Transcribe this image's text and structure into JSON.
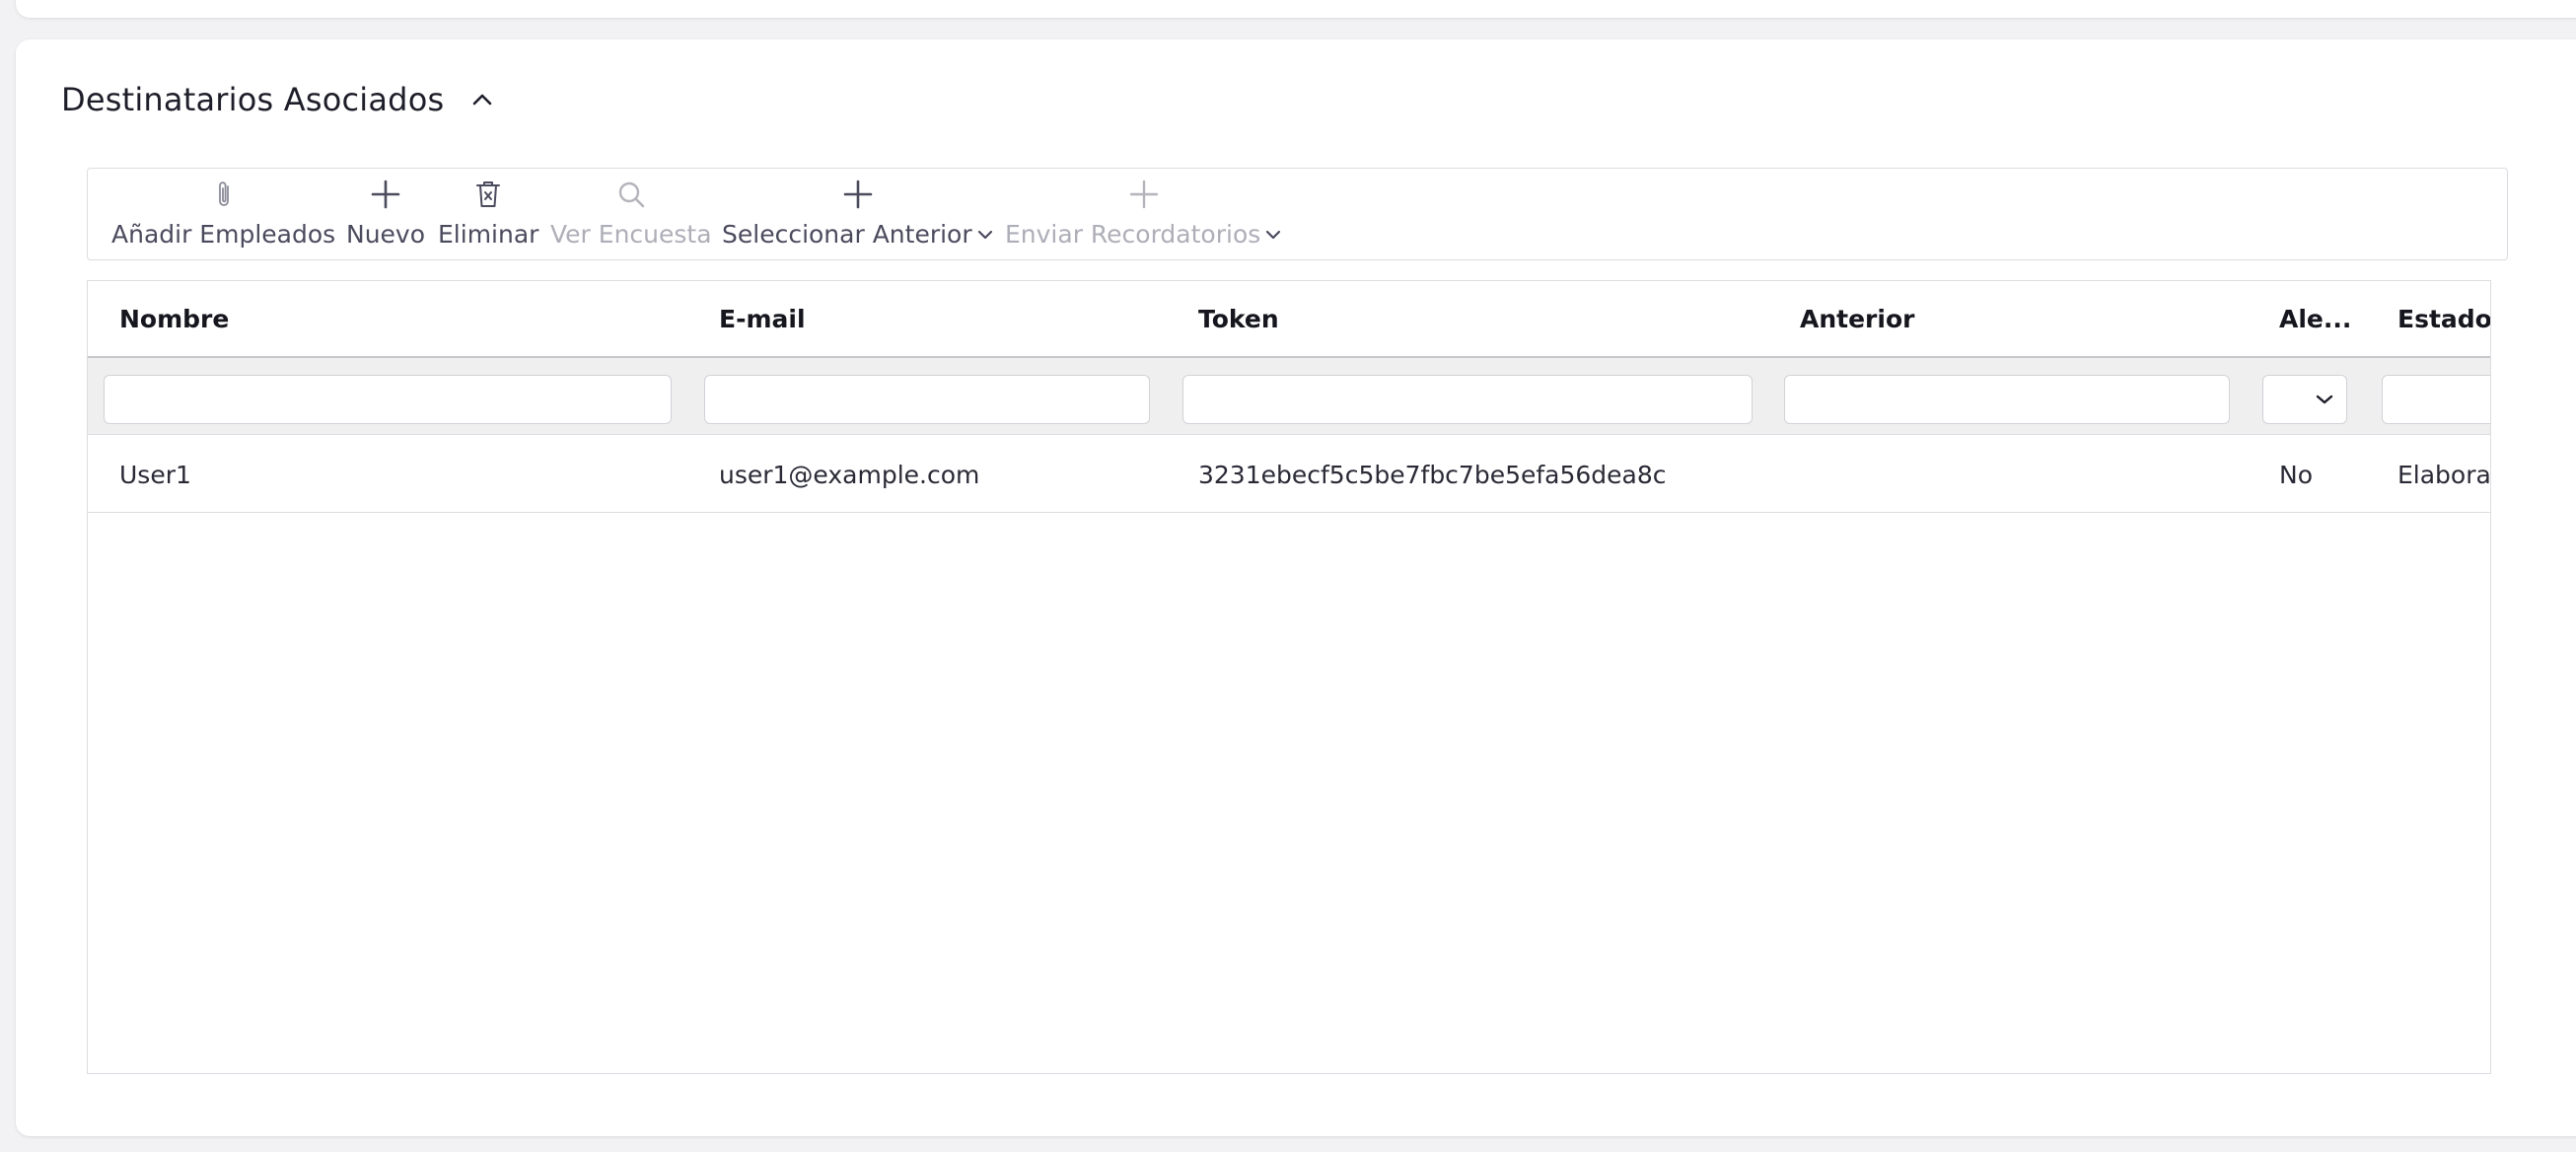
{
  "section": {
    "title": "Destinatarios Asociados"
  },
  "toolbar": {
    "add_employees": "Añadir Empleados",
    "new": "Nuevo",
    "delete": "Eliminar",
    "view_survey": "Ver Encuesta",
    "select_previous": "Seleccionar Anterior",
    "send_reminders": "Enviar Recordatorios"
  },
  "grid": {
    "columns": [
      "Nombre",
      "E-mail",
      "Token",
      "Anterior",
      "Ale...",
      "Estado"
    ],
    "filter_values": [
      "",
      "",
      "",
      "",
      "",
      ""
    ],
    "rows": [
      {
        "nombre": "User1",
        "email": "user1@example.com",
        "token": "3231ebecf5c5be7fbc7be5efa56dea8c",
        "anterior": "",
        "ale": "No",
        "estado": "Elabora"
      }
    ]
  },
  "icons": {
    "add_employees": "paperclip-icon",
    "new": "plus-icon",
    "delete": "trash-icon",
    "view_survey": "search-icon",
    "select_previous": "plus-icon",
    "send_reminders": "plus-icon"
  },
  "colors": {
    "enabled_text": "#4b4b5e",
    "disabled_text": "#aeaeb8",
    "filter_row_bg": "#efefef"
  }
}
